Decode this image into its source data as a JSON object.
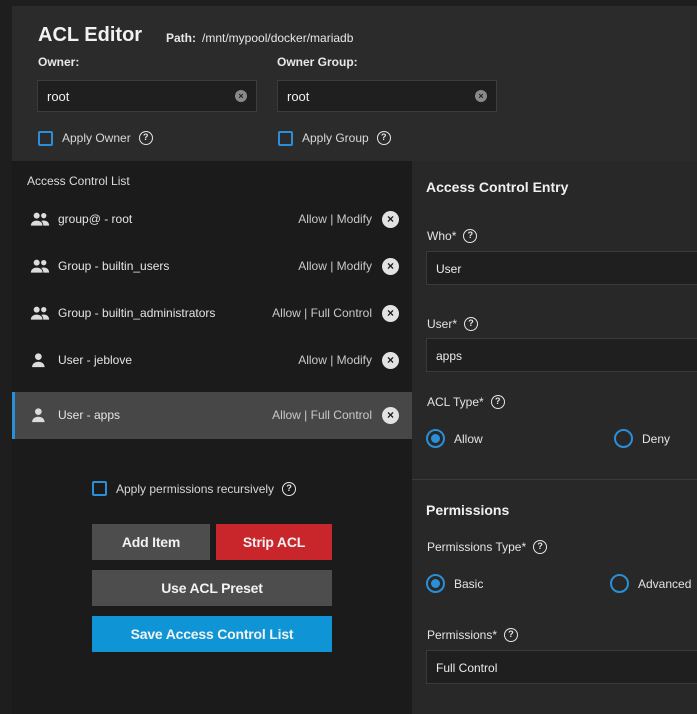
{
  "header": {
    "title": "ACL Editor",
    "path_label": "Path:",
    "path_value": "/mnt/mypool/docker/mariadb",
    "owner_label": "Owner:",
    "owner_value": "root",
    "owner_group_label": "Owner Group:",
    "owner_group_value": "root",
    "apply_owner_label": "Apply Owner",
    "apply_group_label": "Apply Group"
  },
  "acl_list": {
    "heading": "Access Control List",
    "items": [
      {
        "icon": "group-icon",
        "label": "group@ - root",
        "permission": "Allow | Modify",
        "selected": false
      },
      {
        "icon": "group-icon",
        "label": "Group - builtin_users",
        "permission": "Allow | Modify",
        "selected": false
      },
      {
        "icon": "group-icon",
        "label": "Group - builtin_administrators",
        "permission": "Allow | Full Control",
        "selected": false
      },
      {
        "icon": "person-icon",
        "label": "User - jeblove",
        "permission": "Allow | Modify",
        "selected": false
      },
      {
        "icon": "person-icon",
        "label": "User - apps",
        "permission": "Allow | Full Control",
        "selected": true
      }
    ],
    "recursive_label": "Apply permissions recursively",
    "add_item_label": "Add Item",
    "strip_acl_label": "Strip ACL",
    "use_preset_label": "Use ACL Preset",
    "save_label": "Save Access Control List"
  },
  "ace": {
    "title": "Access Control Entry",
    "who_label": "Who",
    "who_value": "User",
    "user_label": "User",
    "user_value": "apps",
    "acl_type_label": "ACL Type",
    "allow_label": "Allow",
    "deny_label": "Deny",
    "required_mark": "*",
    "help_glyph": "?",
    "clear_glyph": "×"
  },
  "permissions": {
    "title": "Permissions",
    "type_label": "Permissions Type",
    "basic_label": "Basic",
    "advanced_label": "Advanced",
    "perm_label": "Permissions",
    "perm_value": "Full Control"
  },
  "colors": {
    "accent": "#2a8fd6",
    "save": "#0f95d6",
    "strip": "#c8262b",
    "button_gray": "#4d4d4d",
    "selected_row": "#474747"
  }
}
